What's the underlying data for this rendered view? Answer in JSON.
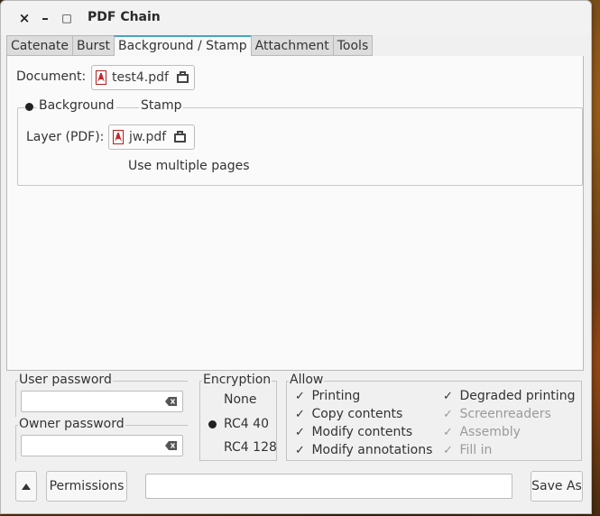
{
  "window": {
    "title": "PDF Chain",
    "controls": {
      "close": "×",
      "minimize": "–",
      "maximize": "□"
    }
  },
  "tabs": [
    {
      "label": "Catenate",
      "active": false
    },
    {
      "label": "Burst",
      "active": false
    },
    {
      "label": "Background / Stamp",
      "active": true
    },
    {
      "label": "Attachment",
      "active": false
    },
    {
      "label": "Tools",
      "active": false
    }
  ],
  "background_stamp": {
    "document_label": "Document:",
    "document_file": "test4.pdf",
    "mode_options": [
      {
        "label": "Background",
        "selected": true
      },
      {
        "label": "Stamp",
        "selected": false
      }
    ],
    "layer_label": "Layer (PDF):",
    "layer_file": "jw.pdf",
    "multiple_pages_label": "Use multiple pages"
  },
  "security": {
    "user_password_label": "User password",
    "user_password_value": "",
    "owner_password_label": "Owner password",
    "owner_password_value": "",
    "encryption_label": "Encryption",
    "encryption_options": [
      {
        "label": "None",
        "selected": false
      },
      {
        "label": "RC4 40",
        "selected": true
      },
      {
        "label": "RC4 128",
        "selected": false
      }
    ],
    "allow_label": "Allow",
    "allow_left": [
      {
        "label": "Printing",
        "checked": true,
        "enabled": true
      },
      {
        "label": "Copy contents",
        "checked": true,
        "enabled": true
      },
      {
        "label": "Modify contents",
        "checked": true,
        "enabled": true
      },
      {
        "label": "Modify annotations",
        "checked": true,
        "enabled": true
      }
    ],
    "allow_right": [
      {
        "label": "Degraded printing",
        "checked": true,
        "enabled": true
      },
      {
        "label": "Screenreaders",
        "checked": true,
        "enabled": false
      },
      {
        "label": "Assembly",
        "checked": true,
        "enabled": false
      },
      {
        "label": "Fill in",
        "checked": true,
        "enabled": false
      }
    ]
  },
  "footer": {
    "toggle_icon": "up-arrow-icon",
    "permissions_label": "Permissions",
    "status_value": "",
    "save_as_label": "Save As"
  },
  "colors": {
    "accent": "#44a5c7",
    "pdf_red": "#c82626"
  }
}
